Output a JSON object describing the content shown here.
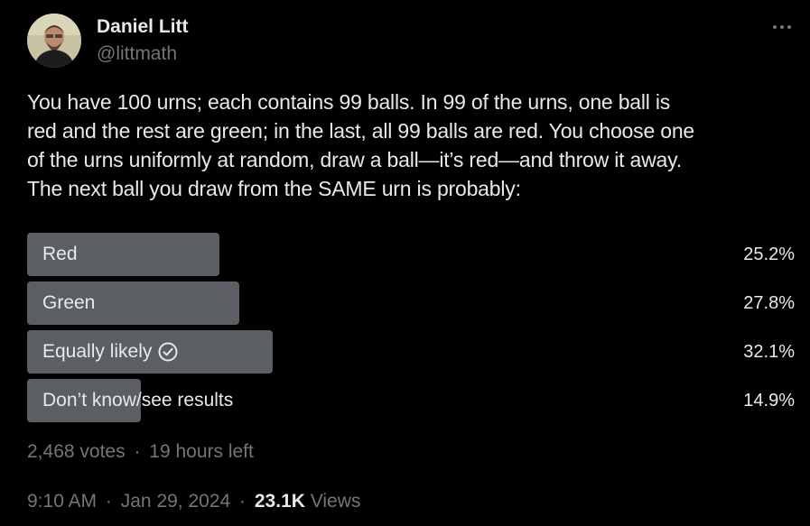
{
  "author": {
    "name": "Daniel Litt",
    "handle": "@littmath"
  },
  "tweet": {
    "text": "You have 100 urns; each contains 99 balls. In 99 of the urns, one ball is\nred and the rest are green; in the last, all 99 balls are red. You choose one\nof the urns uniformly at random, draw a ball—it’s red—and throw it away.\nThe next ball you draw from the SAME urn is probably:"
  },
  "poll": {
    "options": [
      {
        "label": "Red",
        "percent": "25.2%",
        "value": 25.2,
        "voted": false
      },
      {
        "label": "Green",
        "percent": "27.8%",
        "value": 27.8,
        "voted": false
      },
      {
        "label": "Equally likely",
        "percent": "32.1%",
        "value": 32.1,
        "voted": true
      },
      {
        "label": "Don’t know/see results",
        "percent": "14.9%",
        "value": 14.9,
        "voted": false
      }
    ],
    "votes": "2,468 votes",
    "time_left": "19 hours left",
    "separator": "·"
  },
  "meta": {
    "time": "9:10 AM",
    "date": "Jan 29, 2024",
    "views_count": "23.1K",
    "views_label": "Views",
    "separator": "·"
  },
  "colors": {
    "background": "#000000",
    "text": "#e7e9ea",
    "secondary": "#71767b",
    "bar": "#5b5e62"
  },
  "icons": {
    "more": "more-horizontal-icon",
    "voted": "check-circle-icon"
  }
}
